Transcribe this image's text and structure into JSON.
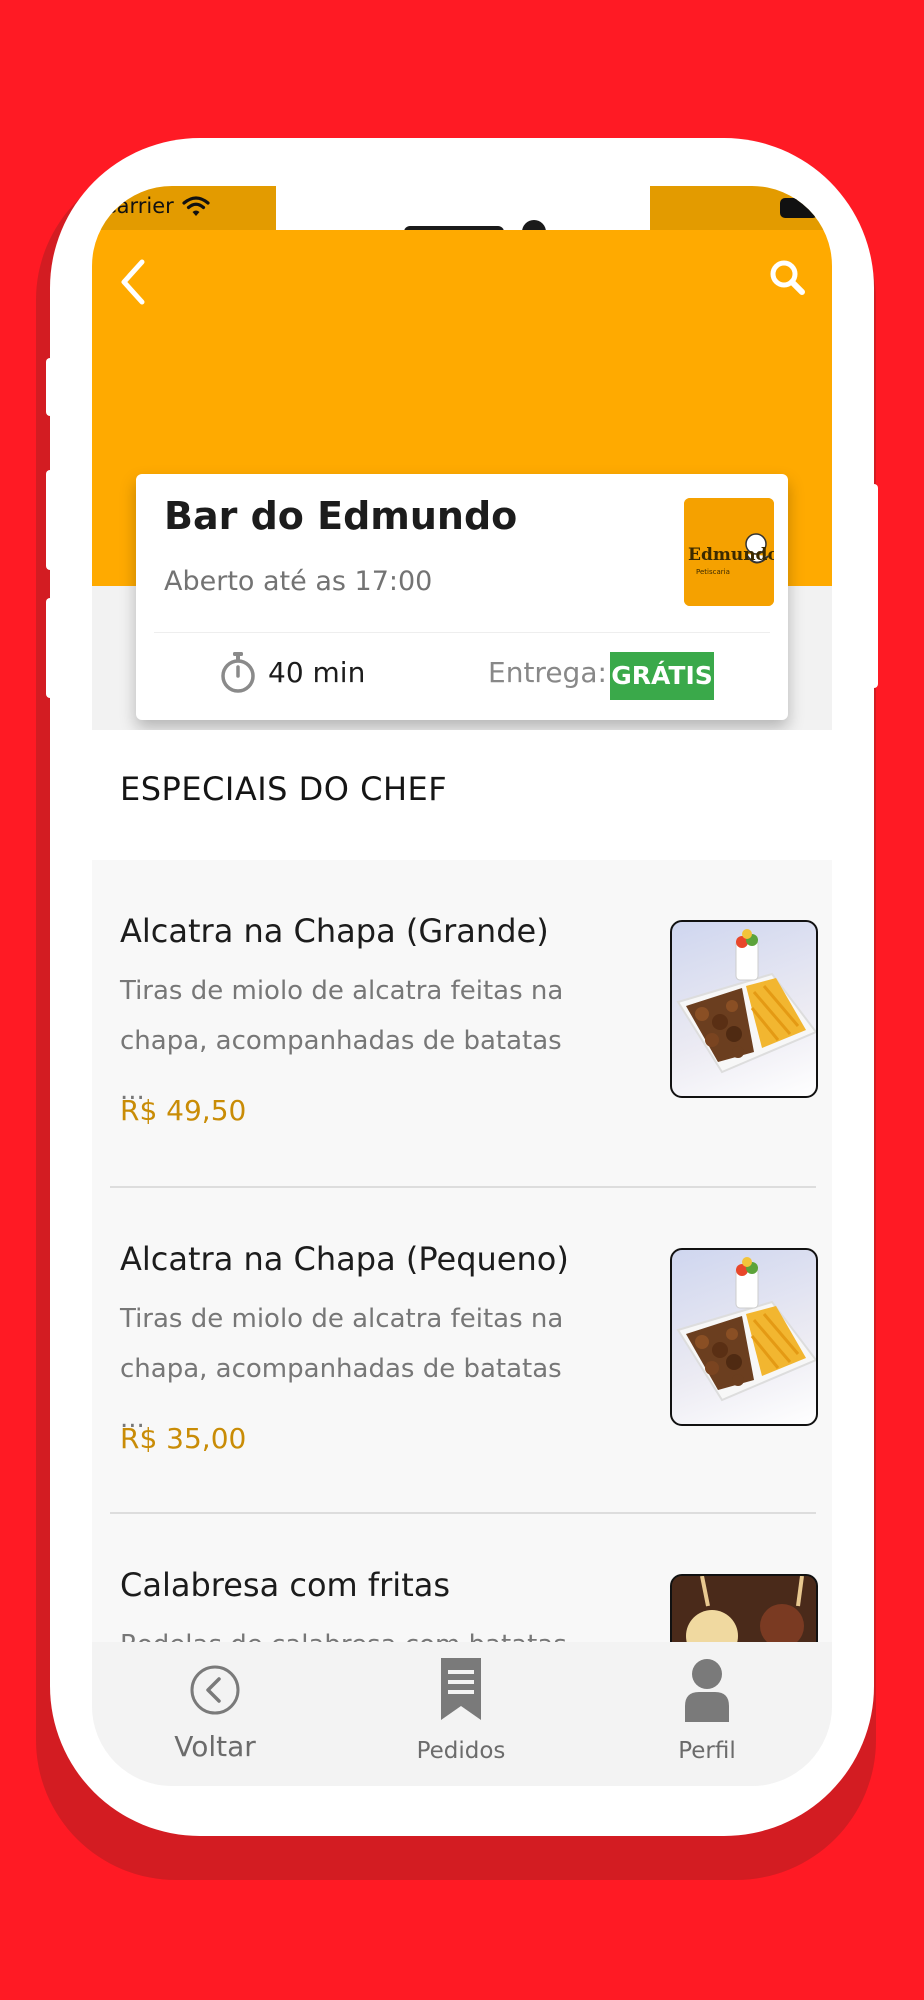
{
  "status_bar": {
    "carrier": "Carrier"
  },
  "header": {
    "back_icon": "chevron-left-icon",
    "search_icon": "search-icon",
    "accent_color": "#ffaa00"
  },
  "restaurant": {
    "name": "Bar do Edmundo",
    "hours": "Aberto até as 17:00",
    "logo_text": "Edmundo",
    "logo_subtext": "Petiscaria",
    "delivery_time": "40 min",
    "delivery_label": "Entrega:",
    "delivery_fee": "GRÁTIS",
    "badge_color": "#3aa94a"
  },
  "section": {
    "title": "ESPECIAIS DO CHEF"
  },
  "menu_items": [
    {
      "name": "Alcatra na Chapa (Grande)",
      "description_line1": "Tiras de miolo de alcatra feitas na",
      "description_line2": "chapa, acompanhadas de batatas ...",
      "price": "R$ 49,50"
    },
    {
      "name": "Alcatra na Chapa (Pequeno)",
      "description_line1": "Tiras de miolo de alcatra feitas na",
      "description_line2": "chapa, acompanhadas de batatas ...",
      "price": "R$ 35,00"
    },
    {
      "name": "Calabresa com fritas",
      "description_line1": "Rodelas de calabresa com batatas",
      "description_line2": "",
      "price": ""
    }
  ],
  "tab_bar": {
    "tabs": [
      {
        "label": "Voltar",
        "icon": "back-circle-icon"
      },
      {
        "label": "Pedidos",
        "icon": "receipt-icon"
      },
      {
        "label": "Perfil",
        "icon": "person-icon"
      }
    ]
  },
  "colors": {
    "background": "#ff1a24",
    "price": "#c98c06"
  }
}
